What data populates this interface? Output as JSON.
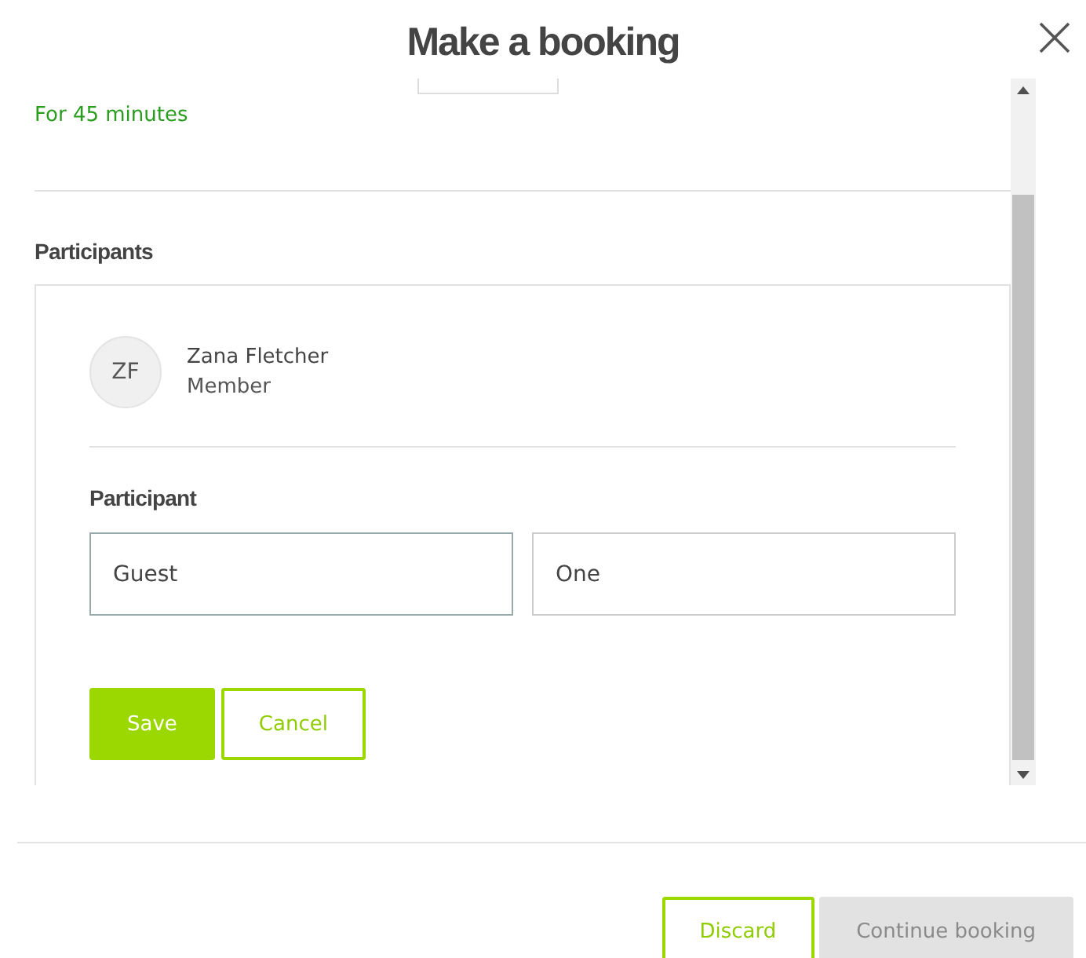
{
  "dialog": {
    "title": "Make a booking"
  },
  "duration": "For 45 minutes",
  "participants": {
    "heading": "Participants",
    "members": [
      {
        "initials": "ZF",
        "name": "Zana Fletcher",
        "role": "Member"
      }
    ],
    "form": {
      "label": "Participant",
      "fields": [
        {
          "value": "Guest"
        },
        {
          "value": "One"
        }
      ],
      "buttons": [
        {
          "label": "Save",
          "kind": "primary"
        },
        {
          "label": "Cancel",
          "kind": "outline"
        }
      ]
    }
  },
  "footer": {
    "buttons": [
      {
        "label": "Discard",
        "disabled": false,
        "kind": "outline"
      },
      {
        "label": "Continue booking",
        "disabled": true,
        "kind": "primary"
      }
    ]
  }
}
